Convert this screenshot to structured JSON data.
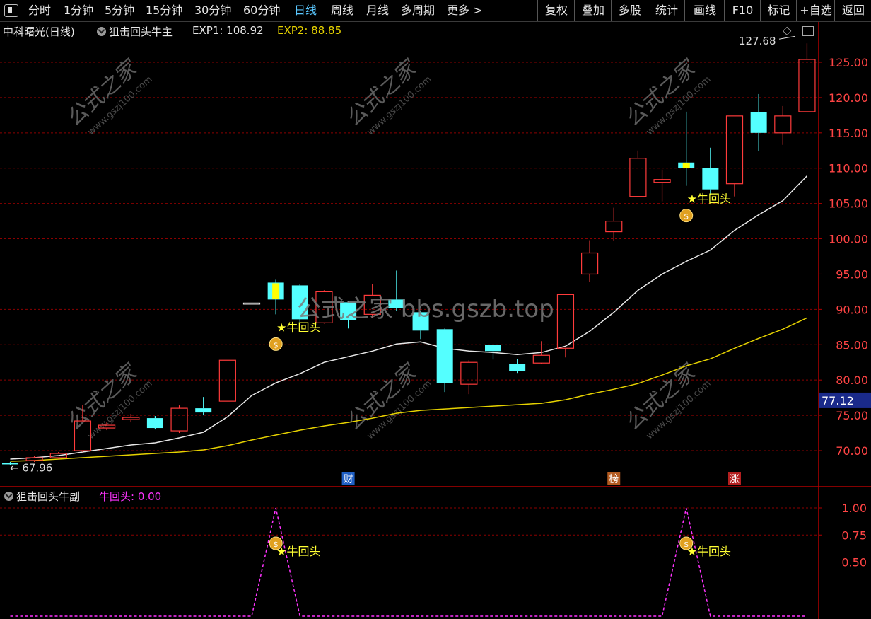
{
  "toolbar": {
    "periods": [
      "分时",
      "1分钟",
      "5分钟",
      "15分钟",
      "30分钟",
      "60分钟",
      "日线",
      "周线",
      "月线",
      "多周期",
      "更多 >"
    ],
    "active_period": "日线",
    "right_buttons": [
      "复权",
      "叠加",
      "多股",
      "统计",
      "画线",
      "F10",
      "标记",
      "+自选",
      "返回"
    ]
  },
  "main_header": {
    "stock": "中科曙光(日线)",
    "indicator": "狙击回头牛主",
    "exp1_label": "EXP1: 108.92",
    "exp2_label": "EXP2: 88.85"
  },
  "sub_header": {
    "indicator": "狙击回头牛副",
    "value_label": "牛回头: 0.00"
  },
  "colors": {
    "up": "#ff3b3b",
    "down": "#54ffff",
    "grid": "#8b0000",
    "ma_fast": "#e8e8e8",
    "ma_slow": "#e6d200",
    "signal": "#ffff33",
    "sub_line": "#ff33ff",
    "axis_text": "#ff4444"
  },
  "watermark": "公式之家 bbs.gszb.top",
  "watermark_small": "公式之家",
  "watermark_url": "www.gszj100.com",
  "chart_data": {
    "type": "candlestick",
    "y_ticks": [
      "125.00",
      "120.00",
      "115.00",
      "110.00",
      "105.00",
      "100.00",
      "95.00",
      "90.00",
      "85.00",
      "80.00",
      "75.00",
      "70.00"
    ],
    "y_tick_values": [
      125,
      120,
      115,
      110,
      105,
      100,
      95,
      90,
      85,
      80,
      75,
      70
    ],
    "ylim": [
      66,
      131
    ],
    "current_price": "77.12",
    "current_price_value": 77.12,
    "high_label": "127.68",
    "low_label": "67.96",
    "candles": [
      {
        "o": 68.2,
        "c": 68.1,
        "h": 68.4,
        "l": 67.96
      },
      {
        "o": 68.6,
        "c": 69.0,
        "h": 69.3,
        "l": 68.4
      },
      {
        "o": 69.0,
        "c": 69.6,
        "h": 69.8,
        "l": 68.8
      },
      {
        "o": 70.0,
        "c": 74.2,
        "h": 76.5,
        "l": 69.8
      },
      {
        "o": 73.2,
        "c": 73.6,
        "h": 74.0,
        "l": 72.9
      },
      {
        "o": 74.4,
        "c": 74.7,
        "h": 75.2,
        "l": 74.0
      },
      {
        "o": 74.6,
        "c": 73.2,
        "h": 74.9,
        "l": 73.0
      },
      {
        "o": 72.8,
        "c": 76.0,
        "h": 76.4,
        "l": 72.5
      },
      {
        "o": 76.0,
        "c": 75.4,
        "h": 77.6,
        "l": 75.0
      },
      {
        "o": 77.0,
        "c": 82.8,
        "h": 82.8,
        "l": 77.0
      },
      {
        "o": 90.9,
        "c": 90.9,
        "h": 90.9,
        "l": 90.9
      },
      {
        "o": 93.8,
        "c": 91.4,
        "h": 94.2,
        "l": 89.3,
        "hl": true
      },
      {
        "o": 93.4,
        "c": 88.6,
        "h": 93.6,
        "l": 88.2
      },
      {
        "o": 88.1,
        "c": 92.5,
        "h": 92.7,
        "l": 88.0
      },
      {
        "o": 91.0,
        "c": 88.5,
        "h": 91.2,
        "l": 87.3
      },
      {
        "o": 89.3,
        "c": 92.0,
        "h": 93.6,
        "l": 88.8
      },
      {
        "o": 91.4,
        "c": 90.2,
        "h": 95.5,
        "l": 89.8
      },
      {
        "o": 89.6,
        "c": 87.0,
        "h": 89.8,
        "l": 85.8
      },
      {
        "o": 87.2,
        "c": 79.6,
        "h": 87.3,
        "l": 78.3
      },
      {
        "o": 79.4,
        "c": 82.5,
        "h": 82.8,
        "l": 78.0
      },
      {
        "o": 85.0,
        "c": 84.1,
        "h": 85.0,
        "l": 82.9
      },
      {
        "o": 82.3,
        "c": 81.3,
        "h": 83.0,
        "l": 81.0
      },
      {
        "o": 82.4,
        "c": 83.5,
        "h": 85.5,
        "l": 82.3
      },
      {
        "o": 84.5,
        "c": 92.1,
        "h": 92.1,
        "l": 83.2
      },
      {
        "o": 95.0,
        "c": 98.0,
        "h": 99.8,
        "l": 93.9
      },
      {
        "o": 101.0,
        "c": 102.5,
        "h": 104.4,
        "l": 99.7
      },
      {
        "o": 106.0,
        "c": 111.4,
        "h": 112.5,
        "l": 106.0
      },
      {
        "o": 108.0,
        "c": 108.4,
        "h": 109.8,
        "l": 105.3
      },
      {
        "o": 110.8,
        "c": 110.0,
        "h": 118.0,
        "l": 107.5,
        "hl": true
      },
      {
        "o": 110.0,
        "c": 107.0,
        "h": 112.9,
        "l": 106.2
      },
      {
        "o": 107.8,
        "c": 117.4,
        "h": 117.4,
        "l": 106.0
      },
      {
        "o": 117.9,
        "c": 115.0,
        "h": 120.5,
        "l": 112.4
      },
      {
        "o": 115.0,
        "c": 117.4,
        "h": 118.8,
        "l": 113.3
      },
      {
        "o": 118.0,
        "c": 125.4,
        "h": 127.68,
        "l": 117.9
      }
    ],
    "ma_fast": [
      68.8,
      69.0,
      69.3,
      69.8,
      70.3,
      70.8,
      71.1,
      71.8,
      72.6,
      74.8,
      77.8,
      79.6,
      80.9,
      82.5,
      83.3,
      84.1,
      85.1,
      85.4,
      84.5,
      84.1,
      83.9,
      83.6,
      83.9,
      84.8,
      86.9,
      89.6,
      92.7,
      95.0,
      96.8,
      98.4,
      101.2,
      103.4,
      105.4,
      108.9
    ],
    "ma_slow": [
      68.5,
      68.6,
      68.8,
      69.0,
      69.2,
      69.4,
      69.6,
      69.8,
      70.1,
      70.7,
      71.5,
      72.2,
      72.9,
      73.5,
      74.0,
      74.6,
      75.3,
      75.7,
      75.9,
      76.1,
      76.3,
      76.5,
      76.7,
      77.2,
      78.0,
      78.7,
      79.5,
      80.7,
      82.0,
      83.0,
      84.5,
      85.9,
      87.2,
      88.8
    ],
    "signals": [
      {
        "index": 11,
        "label": "★牛回头"
      },
      {
        "index": 28,
        "label": "★牛回头"
      }
    ],
    "event_markers": [
      {
        "index": 14,
        "label": "财",
        "color": "#1f5fc4"
      },
      {
        "index": 25,
        "label": "榜",
        "color": "#b35a1f"
      },
      {
        "index": 30,
        "label": "涨",
        "color": "#b31f1f"
      }
    ],
    "sub": {
      "y_ticks": [
        "1.00",
        "0.75",
        "0.50"
      ],
      "y_tick_values": [
        1.0,
        0.75,
        0.5
      ],
      "ylim": [
        0,
        1.1
      ],
      "values": [
        0,
        0,
        0,
        0,
        0,
        0,
        0,
        0,
        0,
        0,
        0,
        1,
        0,
        0,
        0,
        0,
        0,
        0,
        0,
        0,
        0,
        0,
        0,
        0,
        0,
        0,
        0,
        0,
        1,
        0,
        0,
        0,
        0,
        0
      ]
    }
  }
}
